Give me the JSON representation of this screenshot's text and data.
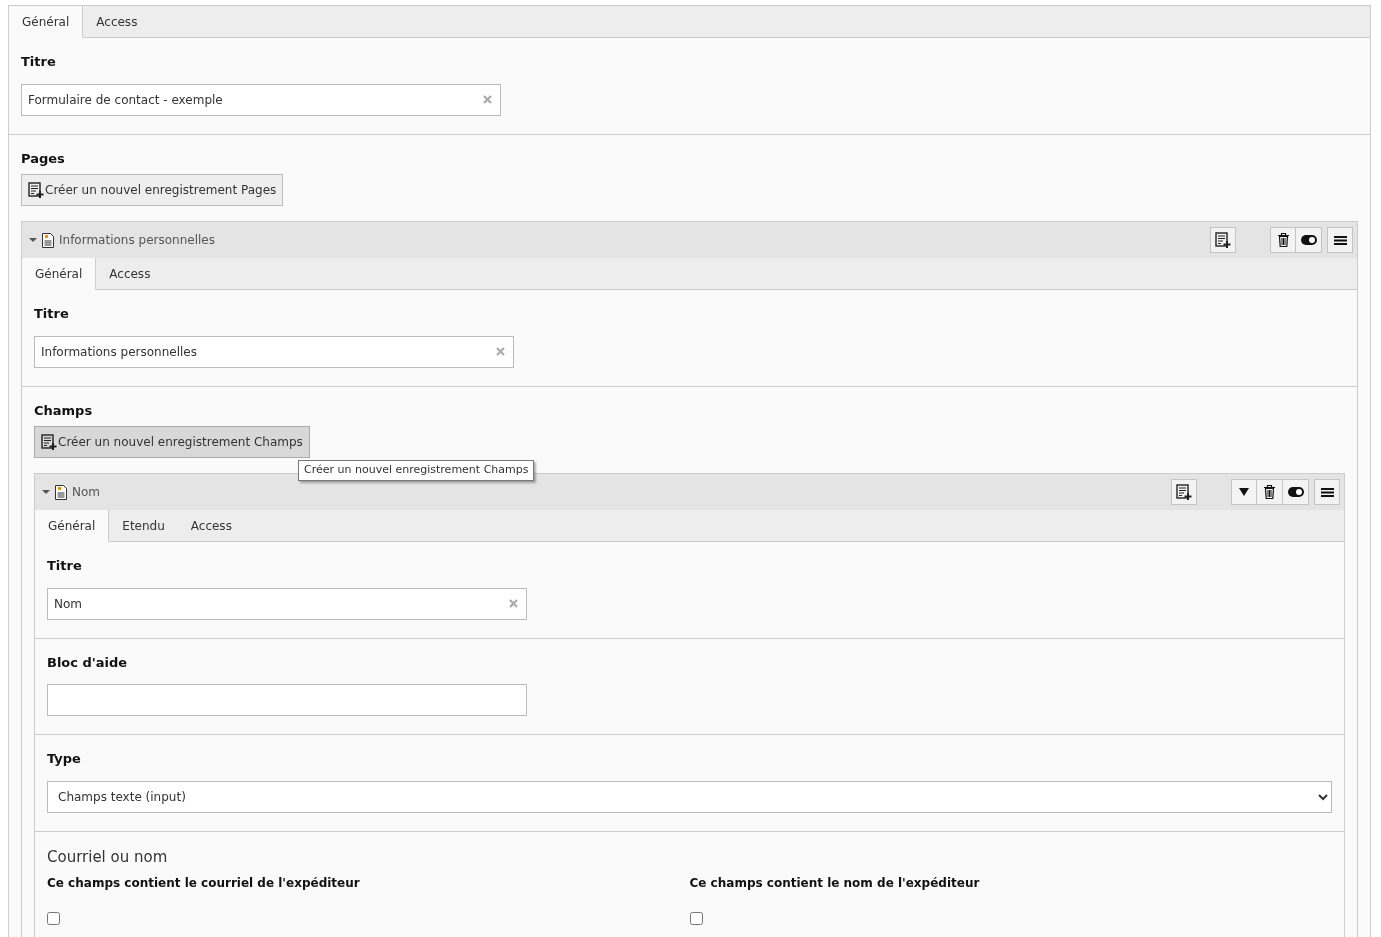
{
  "tabs": [
    {
      "label": "Général",
      "selected": true
    },
    {
      "label": "Access",
      "selected": false
    }
  ],
  "sections": [
    {
      "kind": "text",
      "label": "Titre",
      "value": "Formulaire de contact - exemple"
    },
    {
      "kind": "inline",
      "label": "Pages",
      "button": "Créer un nouvel enregistrement Pages",
      "records": [
        {
          "title": "Informations personnelles",
          "expanded": true,
          "can_move_down": false,
          "tabs": [
            {
              "label": "Général",
              "selected": true
            },
            {
              "label": "Access",
              "selected": false
            }
          ],
          "sections": [
            {
              "kind": "text",
              "label": "Titre",
              "value": "Informations personnelles"
            },
            {
              "kind": "inline",
              "label": "Champs",
              "button": "Créer un nouvel enregistrement Champs",
              "tooltip": "Créer un nouvel enregistrement Champs",
              "records": [
                {
                  "title": "Nom",
                  "expanded": true,
                  "can_move_down": true,
                  "tabs": [
                    {
                      "label": "Général",
                      "selected": true
                    },
                    {
                      "label": "Etendu",
                      "selected": false
                    },
                    {
                      "label": "Access",
                      "selected": false
                    }
                  ],
                  "sections": [
                    {
                      "kind": "text",
                      "label": "Titre",
                      "value": "Nom"
                    },
                    {
                      "kind": "text",
                      "label": "Bloc d'aide"
                    },
                    {
                      "kind": "select",
                      "label": "Type",
                      "value": "Champs texte (input)"
                    },
                    {
                      "kind": "checkgroup",
                      "heading": "Courriel ou nom",
                      "checkboxes": [
                        {
                          "label": "Ce champs contient le courriel de l'expéditeur",
                          "checked": false
                        },
                        {
                          "label": "Ce champs contient le nom de l'expéditeur",
                          "checked": false
                        }
                      ]
                    }
                  ]
                }
              ]
            }
          ]
        }
      ]
    }
  ]
}
